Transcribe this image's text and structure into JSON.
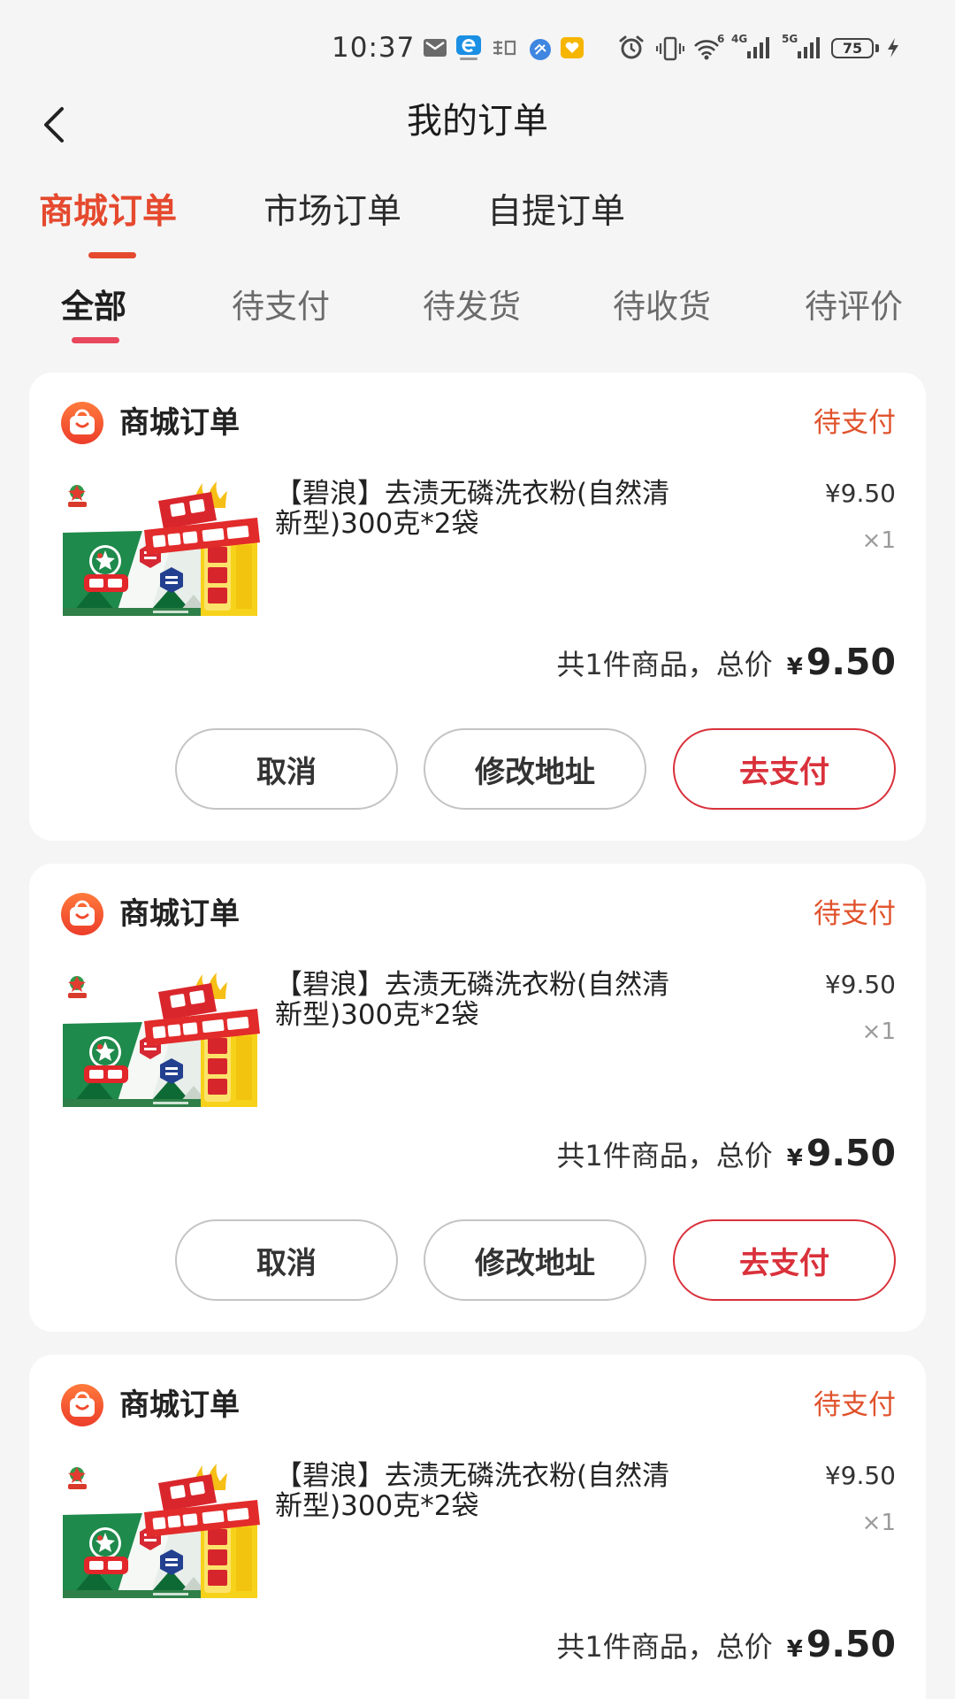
{
  "status_bar": {
    "time": "10:37",
    "wifi_label": "6",
    "sim1_label": "4G",
    "sim2_label": "5G",
    "battery": "75",
    "icons": [
      "mail-notification-icon",
      "browser-app-icon",
      "shopping-app-icon",
      "blue-app-icon",
      "yellow-app-icon",
      "alarm-icon",
      "vibrate-icon",
      "wifi-icon",
      "signal-icon",
      "signal-icon",
      "battery-icon",
      "charging-icon"
    ]
  },
  "header": {
    "title": "我的订单",
    "back_icon": "chevron-left-icon"
  },
  "order_type_tabs": [
    {
      "label": "商城订单",
      "active": true
    },
    {
      "label": "市场订单",
      "active": false
    },
    {
      "label": "自提订单",
      "active": false
    }
  ],
  "status_tabs": [
    {
      "label": "全部",
      "active": true
    },
    {
      "label": "待支付",
      "active": false
    },
    {
      "label": "待发货",
      "active": false
    },
    {
      "label": "待收货",
      "active": false
    },
    {
      "label": "待评价",
      "active": false
    }
  ],
  "orders": [
    {
      "shop": "商城订单",
      "status": "待支付",
      "item": {
        "name": "【碧浪】去渍无磷洗衣粉(自然清新型)300克*2袋",
        "price": "¥9.50",
        "qty": "×1"
      },
      "summary": {
        "count_text": "共1件商品，总价",
        "currency": "¥",
        "total": "9.50"
      },
      "actions": [
        {
          "label": "取消"
        },
        {
          "label": "修改地址"
        },
        {
          "label": "去支付"
        }
      ]
    },
    {
      "shop": "商城订单",
      "status": "待支付",
      "item": {
        "name": "【碧浪】去渍无磷洗衣粉(自然清新型)300克*2袋",
        "price": "¥9.50",
        "qty": "×1"
      },
      "summary": {
        "count_text": "共1件商品，总价",
        "currency": "¥",
        "total": "9.50"
      },
      "actions": [
        {
          "label": "取消"
        },
        {
          "label": "修改地址"
        },
        {
          "label": "去支付"
        }
      ]
    },
    {
      "shop": "商城订单",
      "status": "待支付",
      "item": {
        "name": "【碧浪】去渍无磷洗衣粉(自然清新型)300克*2袋",
        "price": "¥9.50",
        "qty": "×1"
      },
      "summary": {
        "count_text": "共1件商品，总价",
        "currency": "¥",
        "total": "9.50"
      }
    }
  ],
  "colors": {
    "page_background": "#f5f5f5",
    "active_tab": "#e5492e",
    "status_tab_indicator": "#e8475c",
    "order_status": "#e0522c",
    "pay_button": "#d9313b",
    "shop_icon": "#f0502a"
  }
}
